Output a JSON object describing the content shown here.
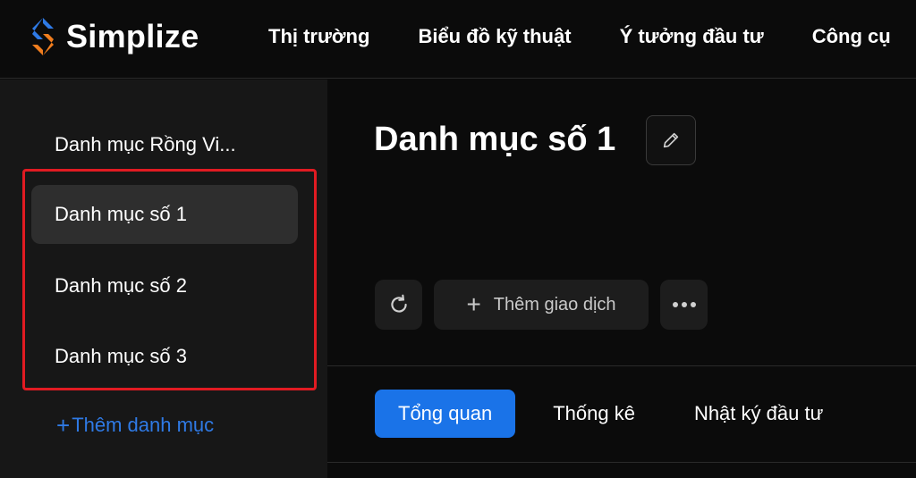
{
  "app": {
    "name": "Simplize"
  },
  "nav": {
    "items": [
      "Thị trường",
      "Biểu đồ kỹ thuật",
      "Ý tưởng đầu tư",
      "Công cụ"
    ]
  },
  "sidebar": {
    "items": [
      {
        "label": "Danh mục Rồng Vi..."
      },
      {
        "label": "Danh mục số 1"
      },
      {
        "label": "Danh mục số 2"
      },
      {
        "label": "Danh mục số 3"
      }
    ],
    "add_label": "Thêm danh mục"
  },
  "main": {
    "title": "Danh mục số 1",
    "toolbar": {
      "add_transaction": "Thêm giao dịch"
    },
    "tabs": [
      "Tổng quan",
      "Thống kê",
      "Nhật ký đầu tư"
    ]
  },
  "colors": {
    "accent": "#1a73e8",
    "highlight": "#e11b22",
    "link": "#2f7ae5"
  },
  "icons": {
    "logo": "simplize-logo",
    "edit": "pencil-icon",
    "refresh": "refresh-icon",
    "add": "plus-icon",
    "more": "more-icon"
  }
}
